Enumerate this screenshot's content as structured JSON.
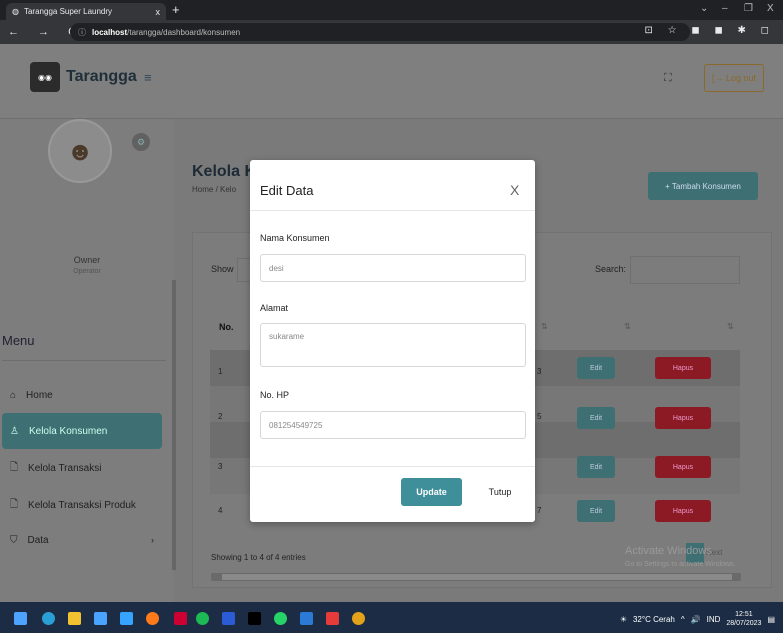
{
  "browser": {
    "tab_title": "Tarangga Super Laundry",
    "tab_close": "x",
    "new_tab": "+",
    "nav": "← → C",
    "url_host": "localhost",
    "url_path": "/tarangga/dashboard/konsumen",
    "ext_icons": "⊡ ☆ ◼ ◼ ✱ ◻"
  },
  "app": {
    "brand": "Tarangga",
    "logout": "[→ Log out",
    "user": {
      "role": "Owner",
      "sub": "Operator"
    },
    "menu_title": "Menu",
    "menu": [
      {
        "label": "Home",
        "icon": "⌂"
      },
      {
        "label": "Kelola Konsumen",
        "icon": "♙"
      },
      {
        "label": "Kelola Transaksi",
        "icon": "🗋"
      },
      {
        "label": "Kelola Transaksi Produk",
        "icon": "🗋"
      },
      {
        "label": "Data",
        "icon": "⛉",
        "chev": "›"
      }
    ],
    "page_title": "Kelola K",
    "breadcrumb": "Home / Kelo",
    "add_button": "+ Tambah Konsumen",
    "table": {
      "show_label": "Show",
      "search_label": "Search:",
      "col_no": "No.",
      "rows": [
        {
          "no": "1",
          "tail": "3",
          "edit": "Edit",
          "delete": "Hapus"
        },
        {
          "no": "2",
          "tail": "5",
          "edit": "Edit",
          "delete": "Hapus"
        },
        {
          "no": "3",
          "tail": "",
          "edit": "Edit",
          "delete": "Hapus"
        },
        {
          "no": "4",
          "tail": "7",
          "edit": "Edit",
          "delete": "Hapus"
        }
      ],
      "showing": "Showing 1 to 4 of 4 entries",
      "next": "Next"
    },
    "watermark": {
      "title": "Activate Windows",
      "sub": "Go to Settings to activate Windows."
    }
  },
  "modal": {
    "title": "Edit Data",
    "close": "X",
    "fields": [
      {
        "label": "Nama Konsumen",
        "value": "desi"
      },
      {
        "label": "Alamat",
        "value": "sukarame"
      },
      {
        "label": "No. HP",
        "value": "081254549725"
      }
    ],
    "update": "Update",
    "tutup": "Tutup"
  },
  "taskbar": {
    "weather": "32°C Cerah",
    "lang": "IND",
    "time": "12:51",
    "date": "28/07/2023"
  }
}
